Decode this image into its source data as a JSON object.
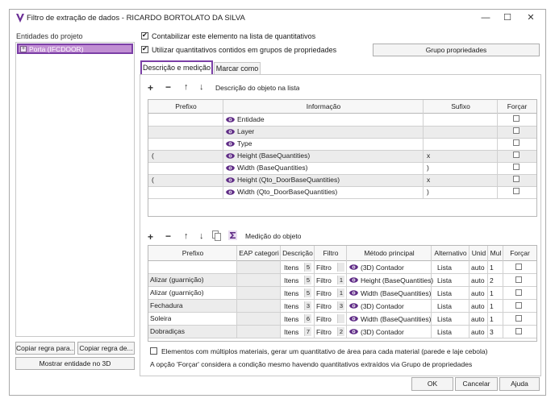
{
  "window": {
    "title": "Filtro de extração de dados - RICARDO BORTOLATO DA SILVA",
    "minimize": "—",
    "maximize": "☐",
    "close": "✕"
  },
  "left": {
    "label": "Entidades do projeto",
    "item": "Porta (IFCDOOR)",
    "copy_rule_to": "Copiar regra para...",
    "copy_rule_from": "Copiar regra de...",
    "show_entity": "Mostrar entidade no 3D"
  },
  "options": {
    "count_element": "Contabilizar este elemento na lista de quantitativos",
    "use_property_groups": "Utilizar quantitativos contidos em grupos de propriedades",
    "property_group_button": "Grupo propriedades"
  },
  "tabs": {
    "description": "Descrição e medição",
    "mark_as": "Marcar como"
  },
  "description_section": {
    "label": "Descrição do objeto na lista",
    "headers": [
      "Prefixo",
      "Informação",
      "Sufixo",
      "Forçar"
    ],
    "rows": [
      {
        "prefix": "",
        "info": "Entidade",
        "suffix": ""
      },
      {
        "prefix": "",
        "info": "Layer",
        "suffix": ""
      },
      {
        "prefix": "",
        "info": "Type",
        "suffix": ""
      },
      {
        "prefix": "(",
        "info": "Height (BaseQuantities)",
        "suffix": "x"
      },
      {
        "prefix": "",
        "info": "Width (BaseQuantities)",
        "suffix": ")"
      },
      {
        "prefix": "(",
        "info": "Height (Qto_DoorBaseQuantities)",
        "suffix": "x"
      },
      {
        "prefix": "",
        "info": "Width (Qto_DoorBaseQuantities)",
        "suffix": ")"
      }
    ]
  },
  "measure_section": {
    "label": "Medição do objeto",
    "headers": [
      "Prefixo",
      "EAP categori",
      "Descrição",
      "Filtro",
      "Método principal",
      "Alternativo",
      "Unid",
      "Mul",
      "Forçar"
    ],
    "rows": [
      {
        "prefix": "",
        "desc": "Itens",
        "desc_n": "5",
        "filter": "Filtro",
        "filter_n": "",
        "method": "(3D) Contador",
        "alt": "Lista",
        "unit": "auto",
        "mul": "1"
      },
      {
        "prefix": "Alizar (guarnição)",
        "desc": "Itens",
        "desc_n": "5",
        "filter": "Filtro",
        "filter_n": "1",
        "method": "Height (BaseQuantities)",
        "alt": "Lista",
        "unit": "auto",
        "mul": "2"
      },
      {
        "prefix": "Alizar (guarnição)",
        "desc": "Itens",
        "desc_n": "5",
        "filter": "Filtro",
        "filter_n": "1",
        "method": "Width (BaseQuantities)",
        "alt": "Lista",
        "unit": "auto",
        "mul": "1"
      },
      {
        "prefix": "Fechadura",
        "desc": "Itens",
        "desc_n": "3",
        "filter": "Filtro",
        "filter_n": "3",
        "method": "(3D) Contador",
        "alt": "Lista",
        "unit": "auto",
        "mul": "1"
      },
      {
        "prefix": "Soleira",
        "desc": "Itens",
        "desc_n": "6",
        "filter": "Filtro",
        "filter_n": "",
        "method": "Width (BaseQuantities)",
        "alt": "Lista",
        "unit": "auto",
        "mul": "1"
      },
      {
        "prefix": "Dobradiças",
        "desc": "Itens",
        "desc_n": "7",
        "filter": "Filtro",
        "filter_n": "2",
        "method": "(3D) Contador",
        "alt": "Lista",
        "unit": "auto",
        "mul": "3"
      }
    ]
  },
  "footer": {
    "multi_material": "Elementos com múltiplos materiais, gerar um quantitativo de área para cada material (parede e laje cebola)",
    "force_note": "A opção 'Forçar' considera a condição mesmo havendo quantitativos extraídos via Grupo de propriedades",
    "ok": "OK",
    "cancel": "Cancelar",
    "help": "Ajuda"
  },
  "colors": {
    "accent": "#7b3fa6",
    "selected_item": "#c18fd3",
    "row_alt": "#ececec"
  }
}
